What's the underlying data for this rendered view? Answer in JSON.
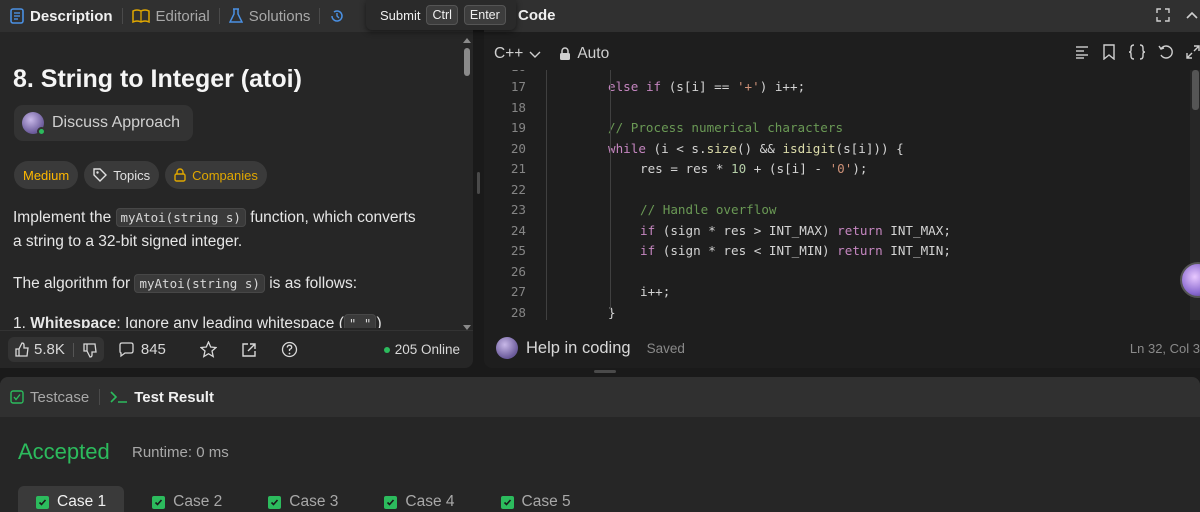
{
  "left_tabs": [
    {
      "label": "Description",
      "icon": "document-icon",
      "color": "#4a90e2"
    },
    {
      "label": "Editorial",
      "icon": "book-icon"
    },
    {
      "label": "Solutions",
      "icon": "flask-icon"
    }
  ],
  "shortcut_tip": {
    "action": "Submit",
    "keys": [
      "Ctrl",
      "Enter"
    ]
  },
  "problem": {
    "title": "8. String to Integer (atoi)",
    "discuss_label": "Discuss Approach",
    "tags": {
      "difficulty": "Medium",
      "topics": "Topics",
      "companies": "Companies"
    },
    "para1_prefix": "Implement the ",
    "para1_code": "myAtoi(string s)",
    "para1_suffix": " function, which converts",
    "para1_line2": "a string to a 32-bit signed integer.",
    "para2_prefix": "The algorithm for ",
    "para2_code": "myAtoi(string s)",
    "para2_suffix": " is as follows:",
    "list_num": "1.",
    "list_bold": "Whitespace",
    "list_rest": ": Ignore any leading whitespace (",
    "list_code": "\" \"",
    "list_end": ")"
  },
  "actions": {
    "likes": "5.8K",
    "comments": "845",
    "online": "205 Online"
  },
  "code_panel": {
    "title": "Code",
    "language": "C++",
    "mode": "Auto",
    "help_label": "Help in coding",
    "saved_label": "Saved",
    "cursor": "Ln 32, Col 3"
  },
  "code_lines": [
    {
      "n": "17",
      "html": "<span class='kw2'>else</span> <span class='kw2'>if</span> (s[i] == <span class='str'>'+'</span>) i++;",
      "indent": 1
    },
    {
      "n": "18",
      "html": "",
      "indent": 1
    },
    {
      "n": "19",
      "html": "<span class='cmt'>// Process numerical characters</span>",
      "indent": 1
    },
    {
      "n": "20",
      "html": "<span class='kw2'>while</span> (i &lt; s.<span class='fn'>size</span>() &amp;&amp; <span class='fn'>isdigit</span>(s[i])) {",
      "indent": 1
    },
    {
      "n": "21",
      "html": "res = res * <span class='num'>10</span> + (s[i] - <span class='str'>'0'</span>);",
      "indent": 2
    },
    {
      "n": "22",
      "html": "",
      "indent": 2
    },
    {
      "n": "23",
      "html": "<span class='cmt'>// Handle overflow</span>",
      "indent": 2
    },
    {
      "n": "24",
      "html": "<span class='kw2'>if</span> (sign * res &gt; INT_MAX) <span class='kw2'>return</span> INT_MAX;",
      "indent": 2
    },
    {
      "n": "25",
      "html": "<span class='kw2'>if</span> (sign * res &lt; INT_MIN) <span class='kw2'>return</span> INT_MIN;",
      "indent": 2
    },
    {
      "n": "26",
      "html": "",
      "indent": 2
    },
    {
      "n": "27",
      "html": "i++;",
      "indent": 2
    },
    {
      "n": "28",
      "html": "}",
      "indent": 1
    }
  ],
  "bottom": {
    "tabs": [
      {
        "label": "Testcase"
      },
      {
        "label": "Test Result"
      }
    ],
    "status": "Accepted",
    "runtime": "Runtime: 0 ms",
    "cases": [
      "Case 1",
      "Case 2",
      "Case 3",
      "Case 4",
      "Case 5"
    ]
  },
  "colors": {
    "accepted": "#2cbb5d",
    "medium": "#ffb800",
    "accent": "#4a90e2"
  }
}
